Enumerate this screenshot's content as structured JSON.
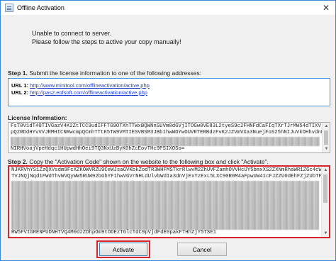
{
  "window": {
    "title": "Offline Activation",
    "close_glyph": "✕"
  },
  "message": {
    "line1": "Unable to connect to server.",
    "line2": "Please follow the steps to active your copy manually!"
  },
  "step1": {
    "prefix": "Step 1.",
    "text": " Submit the license information to one of the following addresses:",
    "urls": [
      {
        "label": "URL 1:",
        "href": "http://www.minitool.com/offlineactivation/active.php"
      },
      {
        "label": "URL 2:",
        "href": "http://pas2.eofsoft.com/offlineactivation/active.php"
      }
    ]
  },
  "license": {
    "label": "License Information:",
    "line_first": "FsT0V1dT40TIVGazV4K2ZtTCC9udIFFTG9OTXhTTWxBQWNnSUVm0dGVjITOGw0VE83L2tyeS9c2FHNFdCaFIqTXrTJrMW54dTIXVjV1M3FKVjv",
    "line_second": "pQ2RDdHYvVVJRMHICNRwcmpQCmhTTtK5TW9VMTIESVBSM3JBb1hwWDYwOUVRTERBdzFvK2JZVmVXa3NuejFoS25hNIJuVkOHhvdnR",
    "line_last": "NIRHVoajVpeHdqc1HUpwdHhOei9TQ3NxUzByK0hZcEovTHc9PSIXOSo="
  },
  "step2": {
    "prefix": "Step 2.",
    "text": " Copy the \"Activation Code\" shown on the website to the following box and click \"Activate\".",
    "line_first": "NJKRVhYS1ZzQXVsdm9FcXZKOWVRZU9CeWJsaGVKbkZodTR3WHFMSTkrRlwvM2ZhUVFZamhOVVHcUY5bmxXS2ZXNmRhaWR1ZGc4cW1rQ",
    "line_second": "TVJNQjNqd1FWdThvWVQyWW5RUW92bGhYF1hwVGVrNHLdUlvbWdIa3dnVjExYzExL5LXC90R0M4aFpwUW41cFJZZU0dEhFZjZUbTFpb",
    "line_last": "RW5FVIGRENPUDNHTVQ4M0dzZDhpOm9tODEzTGlcTdC9pVjdFdE0pakFTHhZjY5TSE1"
  },
  "buttons": {
    "activate": "Activate",
    "cancel": "Cancel"
  }
}
